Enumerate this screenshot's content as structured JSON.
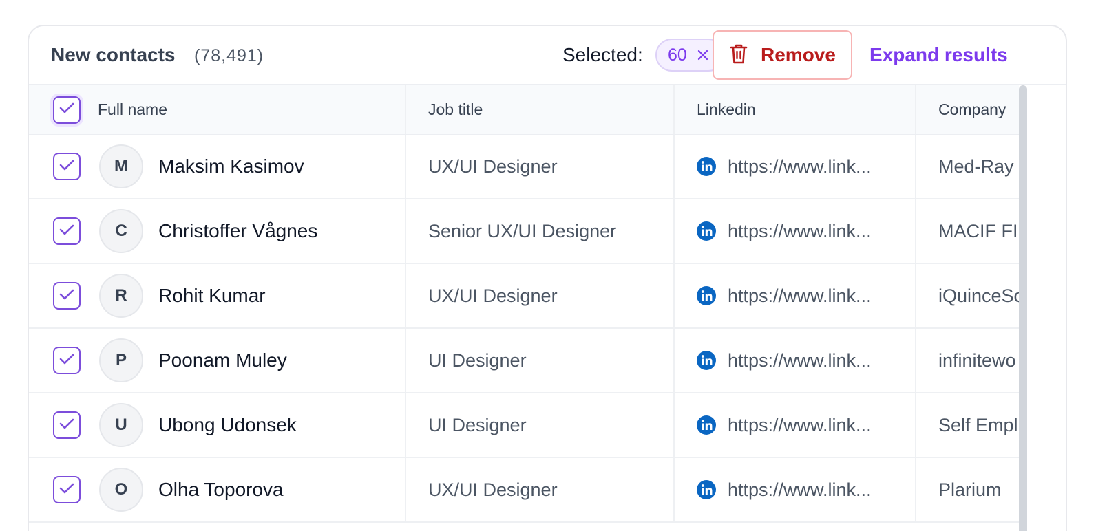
{
  "header": {
    "title": "New contacts",
    "count": "(78,491)",
    "selected_label": "Selected:",
    "selected_count": "60",
    "remove_label": "Remove",
    "expand_label": "Expand results"
  },
  "columns": [
    "Full name",
    "Job title",
    "Linkedin",
    "Company"
  ],
  "rows": [
    {
      "initial": "M",
      "name": "Maksim Kasimov",
      "job": "UX/UI Designer",
      "linkedin": "https://www.link...",
      "company": "Med-Ray"
    },
    {
      "initial": "C",
      "name": "Christoffer Vågnes",
      "job": "Senior UX/UI Designer",
      "linkedin": "https://www.link...",
      "company": "MACIF FI"
    },
    {
      "initial": "R",
      "name": "Rohit Kumar",
      "job": "UX/UI Designer",
      "linkedin": "https://www.link...",
      "company": "iQuinceSo"
    },
    {
      "initial": "P",
      "name": "Poonam Muley",
      "job": "UI Designer",
      "linkedin": "https://www.link...",
      "company": "infinitewo"
    },
    {
      "initial": "U",
      "name": "Ubong Udonsek",
      "job": "UI Designer",
      "linkedin": "https://www.link...",
      "company": "Self Empl"
    },
    {
      "initial": "O",
      "name": "Olha Toporova",
      "job": "UX/UI Designer",
      "linkedin": "https://www.link...",
      "company": "Plarium"
    }
  ],
  "icons": {
    "remove": "trash-icon",
    "clear_selection": "close-icon",
    "linkedin": "linkedin-icon",
    "checkbox": "checkmark-icon"
  },
  "colors": {
    "accent": "#7c3aed",
    "danger": "#b91c1c",
    "linkedin": "#0a66c2"
  }
}
